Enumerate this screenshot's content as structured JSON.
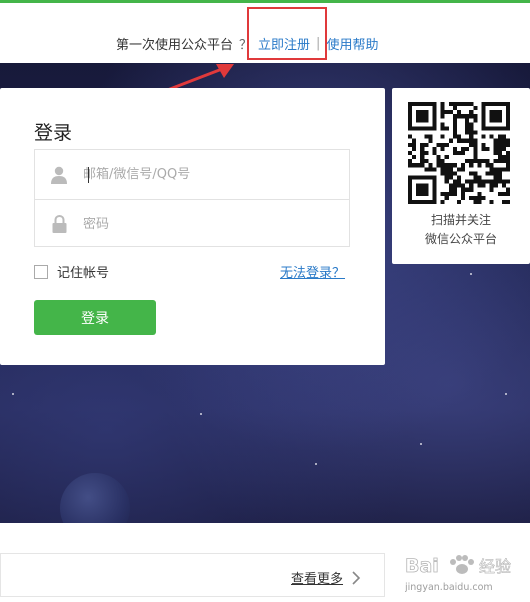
{
  "topbar": {
    "prompt_text": "第一次使用公众平台",
    "question_mark": "？",
    "register_link": "立即注册",
    "separator": "|",
    "help_link": "使用帮助"
  },
  "login": {
    "title": "登录",
    "username_placeholder": "邮箱/微信号/QQ号",
    "password_placeholder": "密码",
    "remember_label": "记住帐号",
    "forgot_link": "无法登录？",
    "submit_label": "登录"
  },
  "qr": {
    "caption_line1": "扫描并关注",
    "caption_line2": "微信公众平台"
  },
  "footer": {
    "more_label": "查看更多"
  },
  "watermark": {
    "brand": "Bai",
    "brand_suffix": "经验",
    "url": "jingyan.baidu.com"
  },
  "colors": {
    "accent_green": "#44b549",
    "link_blue": "#2a7ac8",
    "highlight_red": "#e0393b"
  }
}
